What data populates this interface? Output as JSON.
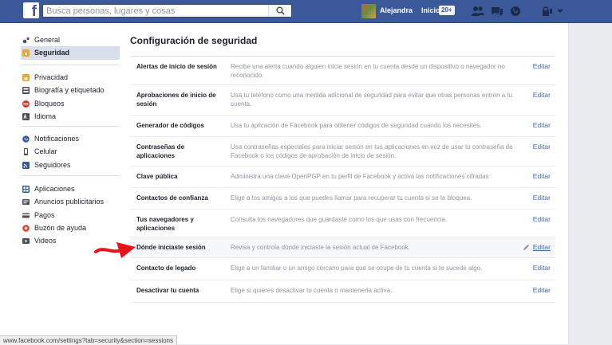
{
  "topbar": {
    "logo_letter": "f",
    "search_placeholder": "Busca personas, lugares y cosas",
    "user_name": "Alejandra",
    "home_label": "Inicio",
    "home_badge": "20+"
  },
  "sidebar": {
    "groups": [
      [
        {
          "label": "General",
          "icon": "gear-icon"
        },
        {
          "label": "Seguridad",
          "icon": "shield-icon",
          "active": true
        }
      ],
      [
        {
          "label": "Privacidad",
          "icon": "lock-icon"
        },
        {
          "label": "Biografía y etiquetado",
          "icon": "timeline-icon"
        },
        {
          "label": "Bloqueos",
          "icon": "block-icon"
        },
        {
          "label": "Idioma",
          "icon": "language-icon"
        }
      ],
      [
        {
          "label": "Notificaciones",
          "icon": "globe-icon"
        },
        {
          "label": "Celular",
          "icon": "mobile-icon"
        },
        {
          "label": "Seguidores",
          "icon": "rss-icon"
        }
      ],
      [
        {
          "label": "Aplicaciones",
          "icon": "apps-icon"
        },
        {
          "label": "Anuncios publicitarios",
          "icon": "ads-icon"
        },
        {
          "label": "Pagos",
          "icon": "card-icon"
        },
        {
          "label": "Buzón de ayuda",
          "icon": "lifebuoy-icon"
        },
        {
          "label": "Videos",
          "icon": "video-icon"
        }
      ]
    ]
  },
  "main": {
    "title": "Configuración de seguridad",
    "edit_label": "Editar",
    "rows": [
      {
        "label": "Alertas de inicio de sesión",
        "desc": "Recibe una alerta cuando alguien inicie sesión en tu cuenta desde un dispositivo o navegador no reconocido."
      },
      {
        "label": "Aprobaciones de inicio de sesión",
        "desc": "Usa tu teléfono como una medida adicional de seguridad para evitar que otras personas entren a tu cuenta."
      },
      {
        "label": "Generador de códigos",
        "desc": "Usa tu aplicación de Facebook para obtener códigos de seguridad cuando los necesites."
      },
      {
        "label": "Contraseñas de aplicaciones",
        "desc": "Usa contraseñas especiales para iniciar sesión en tus aplicaciones en vez de usar tu contraseña de Facebook o los códigos de aprobación de inicio de sesión."
      },
      {
        "label": "Clave pública",
        "desc": "Administra una clave OpenPGP en tu perfil de Facebook y activa las notificaciones cifradas"
      },
      {
        "label": "Contactos de confianza",
        "desc": "Elige a los amigos a los que puedes llamar para recuperar tu cuenta si se te bloquea."
      },
      {
        "label": "Tus navegadores y aplicaciones",
        "desc": "Consulta los navegadores que guardaste como los que usas con frecuencia."
      },
      {
        "label": "Dónde iniciaste sesión",
        "desc": "Revisa y controla dónde iniciaste la sesión actual de Facebook.",
        "highlight": true
      },
      {
        "label": "Contacto de legado",
        "desc": "Elige a un familiar o un amigo cercano para que se ocupe de tu cuenta si te sucede algo."
      },
      {
        "label": "Desactivar tu cuenta",
        "desc": "Elige si quieres desactivar tu cuenta o mantenerla activa."
      }
    ]
  },
  "status_url": "www.facebook.com/settings?tab=security&section=sessions",
  "colors": {
    "brand": "#3b5998",
    "link": "#4267b2",
    "arrow": "#e8141c"
  }
}
